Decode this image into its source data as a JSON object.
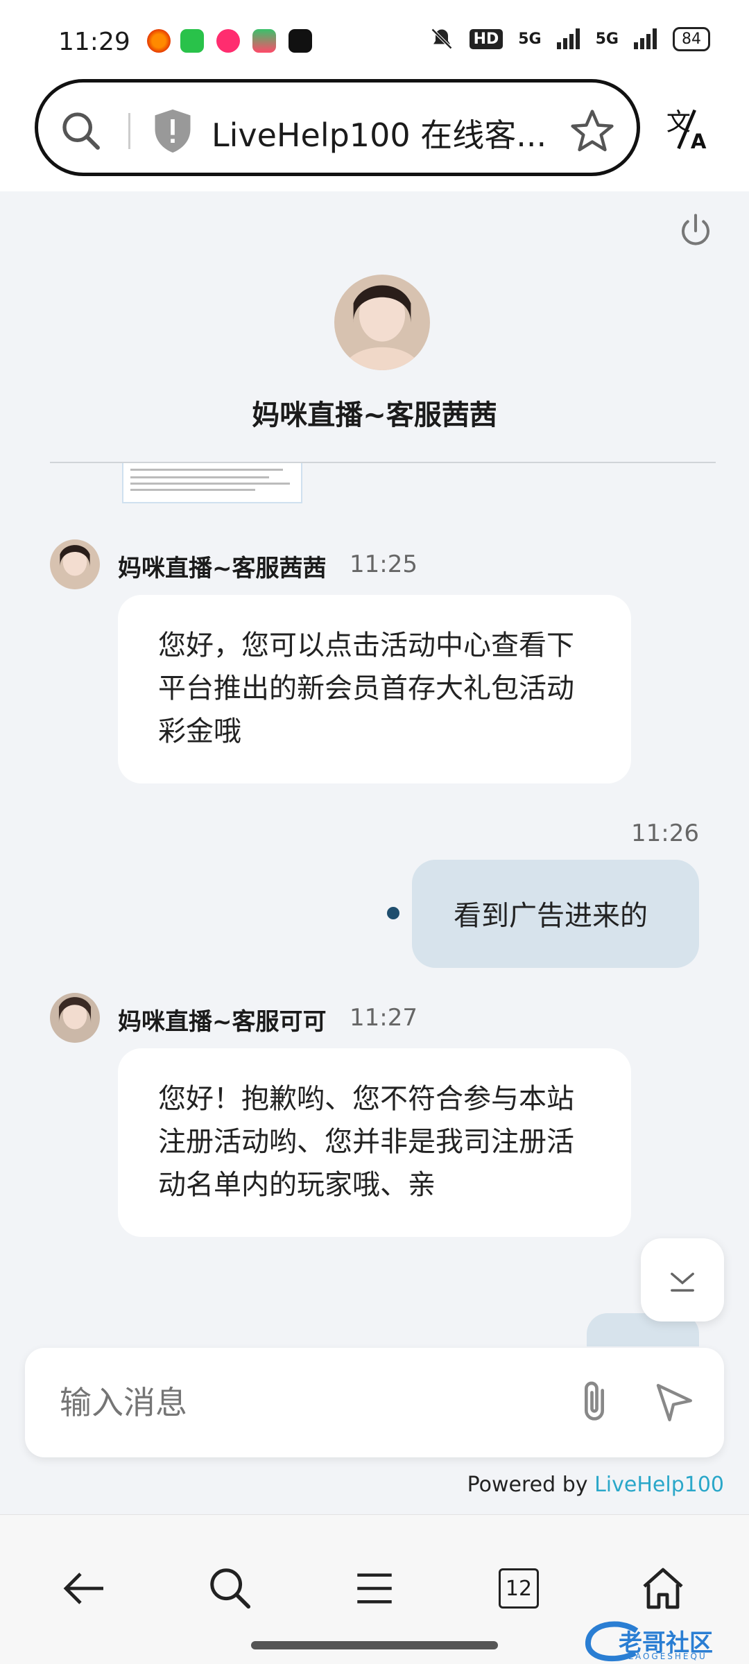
{
  "status_bar": {
    "time": "11:29",
    "hd": "HD",
    "network_1": "5G",
    "network_2": "5G",
    "battery": "84"
  },
  "address_bar": {
    "url_text": "LiveHelp100 在线客..."
  },
  "chat": {
    "agent_header_name": "妈咪直播~客服茜茜",
    "messages": [
      {
        "sender": "妈咪直播~客服茜茜",
        "time": "11:25",
        "text": "您好，您可以点击活动中心查看下 平台推出的新会员首存大礼包活动彩金哦"
      },
      {
        "sender": "user",
        "time": "11:26",
        "text": "看到广告进来的"
      },
      {
        "sender": "妈咪直播~客服可可",
        "time": "11:27",
        "text": "您好！抱歉哟、您不符合参与本站注册活动哟、您并非是我司注册活动名单内的玩家哦、亲"
      }
    ]
  },
  "composer": {
    "placeholder": "输入消息"
  },
  "footer": {
    "powered_prefix": "Powered by",
    "powered_link": "LiveHelp100"
  },
  "nav": {
    "tabs_count": "12"
  },
  "watermark": {
    "text": "老哥社区",
    "sub": "LAOGESHEQU"
  },
  "colors": {
    "accent_link": "#2aa7c9",
    "user_bubble": "#d7e3ec",
    "chat_bg": "#f2f4f7"
  }
}
